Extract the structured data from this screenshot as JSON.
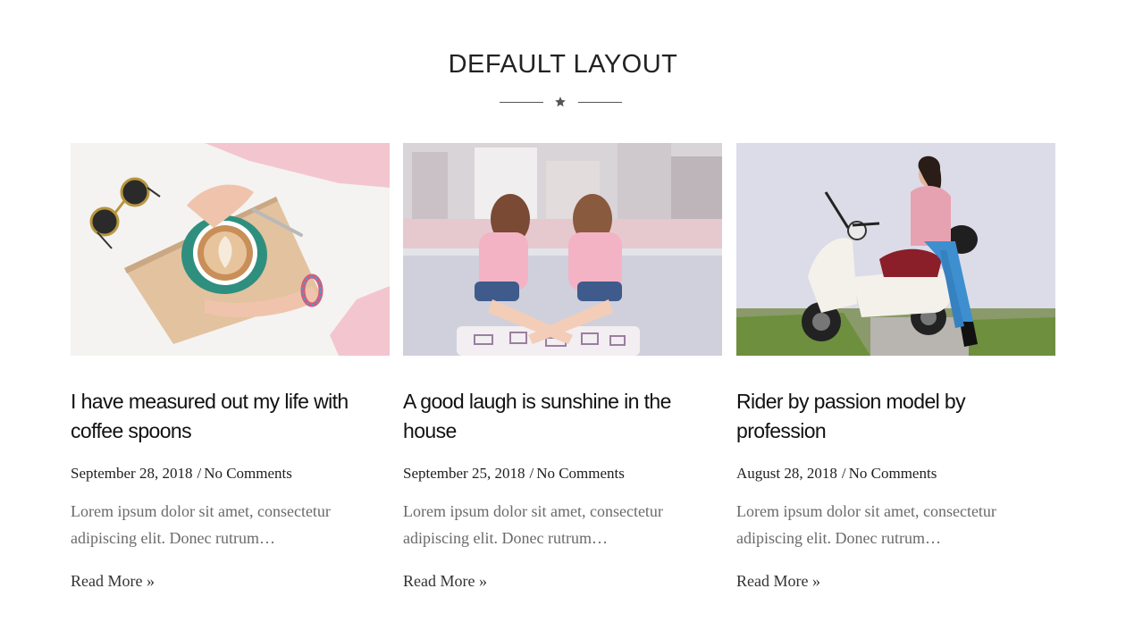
{
  "section": {
    "title": "DEFAULT LAYOUT",
    "divider_icon": "star-icon"
  },
  "posts": [
    {
      "image_icon": "coffee-photo",
      "title": "I have measured out my life with coffee spoons",
      "date": "September 28, 2018",
      "separator": "/",
      "comments": "No Comments",
      "excerpt": "Lorem ipsum dolor sit amet, consectetur adipiscing elit. Donec rutrum…",
      "read_more": "Read More »"
    },
    {
      "image_icon": "friends-photo",
      "title": "A good laugh is sunshine in the house",
      "date": "September 25, 2018",
      "separator": "/",
      "comments": "No Comments",
      "excerpt": "Lorem ipsum dolor sit amet, consectetur adipiscing elit. Donec rutrum…",
      "read_more": "Read More »"
    },
    {
      "image_icon": "scooter-photo",
      "title": "Rider by passion model by profession",
      "date": "August 28, 2018",
      "separator": "/",
      "comments": "No Comments",
      "excerpt": "Lorem ipsum dolor sit amet, consectetur adipiscing elit. Donec rutrum…",
      "read_more": "Read More »"
    }
  ]
}
